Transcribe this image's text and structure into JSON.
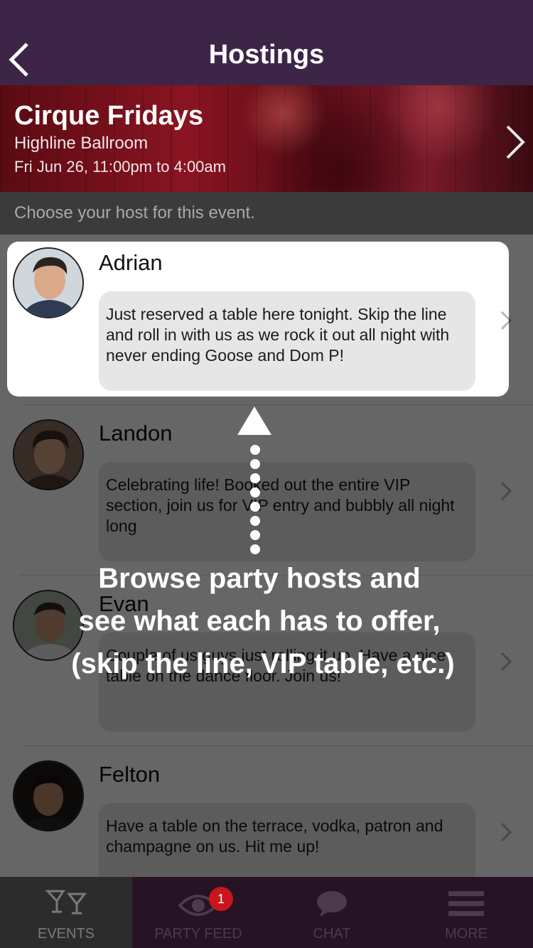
{
  "nav": {
    "title": "Hostings"
  },
  "event": {
    "name": "Cirque Fridays",
    "venue": "Highline Ballroom",
    "datetime": "Fri Jun 26, 11:00pm to 4:00am"
  },
  "prompt": "Choose your host for this event.",
  "hosts": [
    {
      "name": "Adrian",
      "message": "Just reserved a table here tonight. Skip the line and roll in with us as we rock it out all night with never ending Goose and Dom P!"
    },
    {
      "name": "Landon",
      "message": "Celebrating life! Booked out the entire VIP section, join us for VIP entry and bubbly all night long"
    },
    {
      "name": "Evan",
      "message": "Couple of us guys just rolling it up. Have a nice table on the dance floor. Join us!"
    },
    {
      "name": "Felton",
      "message": "Have a table on the terrace, vodka, patron and champagne on us. Hit me up!"
    }
  ],
  "tooltip": {
    "lines": [
      "Browse party hosts and",
      "see what each has to offer,",
      "(skip the line, VIP table, etc.)"
    ]
  },
  "tabs": [
    {
      "label": "EVENTS",
      "icon": "cocktail-glasses-icon",
      "active": true
    },
    {
      "label": "PARTY FEED",
      "icon": "eye-icon",
      "badge": "1"
    },
    {
      "label": "CHAT",
      "icon": "chat-bubble-icon"
    },
    {
      "label": "MORE",
      "icon": "hamburger-menu-icon"
    }
  ],
  "colors": {
    "header": "#3d2548",
    "tab_bar": "#261425",
    "badge": "#c9161d"
  }
}
